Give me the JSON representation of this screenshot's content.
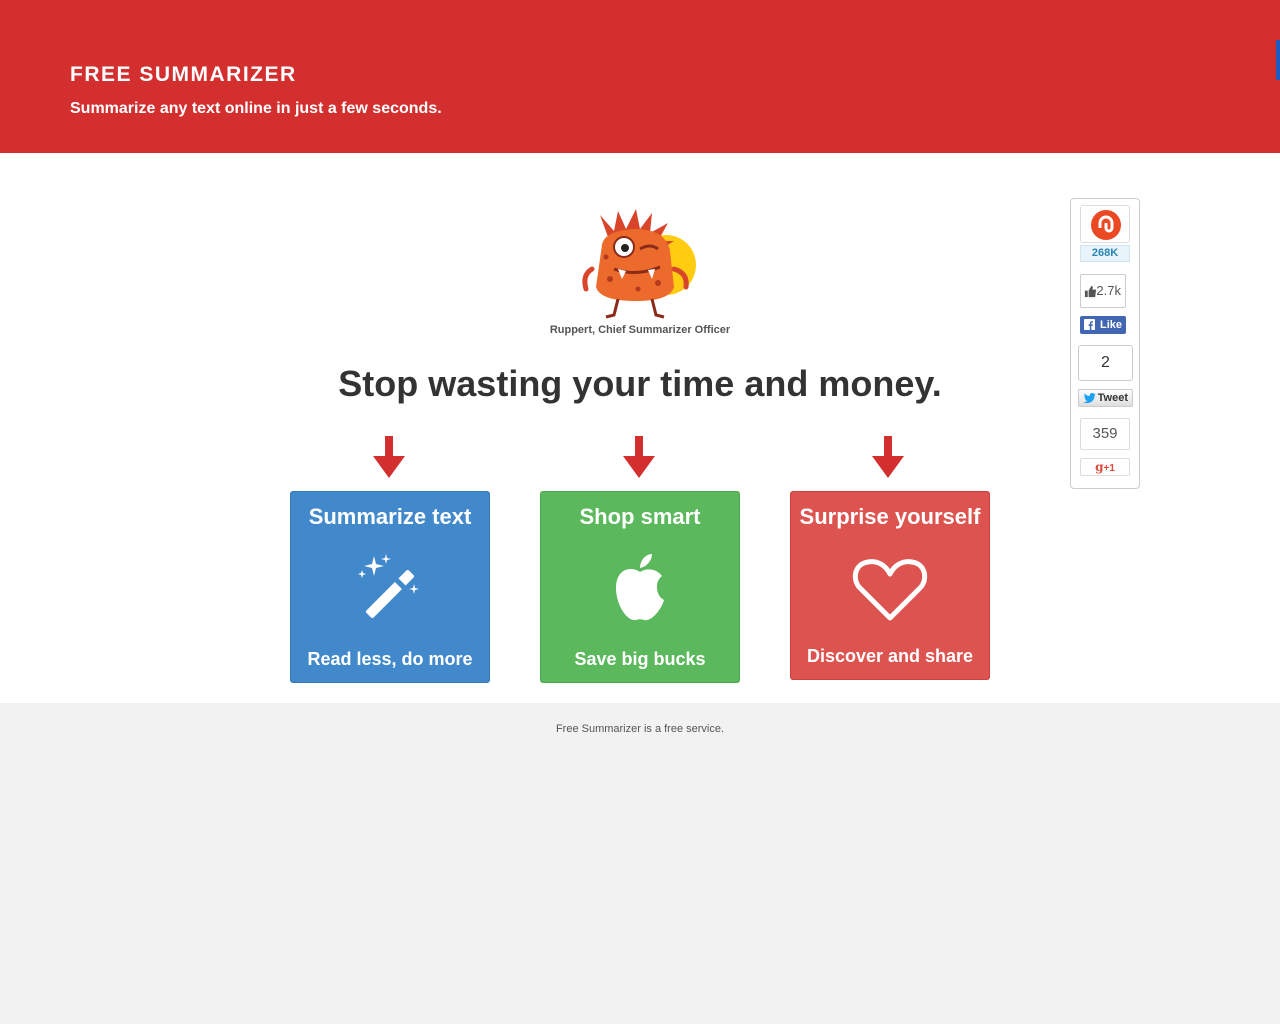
{
  "header": {
    "brand": "FREE SUMMARIZER",
    "tagline": "Summarize any text online in just a few seconds."
  },
  "mascot": {
    "caption": "Ruppert, Chief Summarizer Officer"
  },
  "headline": "Stop wasting your time and money.",
  "cards": [
    {
      "title": "Summarize text",
      "subtitle": "Read less, do more",
      "icon": "magic-wand-icon",
      "color": "#4289cc"
    },
    {
      "title": "Shop smart",
      "subtitle": "Save big bucks",
      "icon": "apple-icon",
      "color": "#5cb85c"
    },
    {
      "title": "Surprise yourself",
      "subtitle": "Discover and share",
      "icon": "heart-icon",
      "color": "#dc534f"
    }
  ],
  "share": {
    "stumbleupon_count": "268K",
    "facebook_count": "2.7k",
    "facebook_label": "Like",
    "twitter_count": "2",
    "twitter_label": "Tweet",
    "googleplus_count": "359",
    "googleplus_label": "+1"
  },
  "footer": {
    "text": "Free Summarizer is a free service."
  },
  "colors": {
    "header": "#d32f2f",
    "arrow": "#d32f2f",
    "page_background": "#f2f2f2"
  }
}
